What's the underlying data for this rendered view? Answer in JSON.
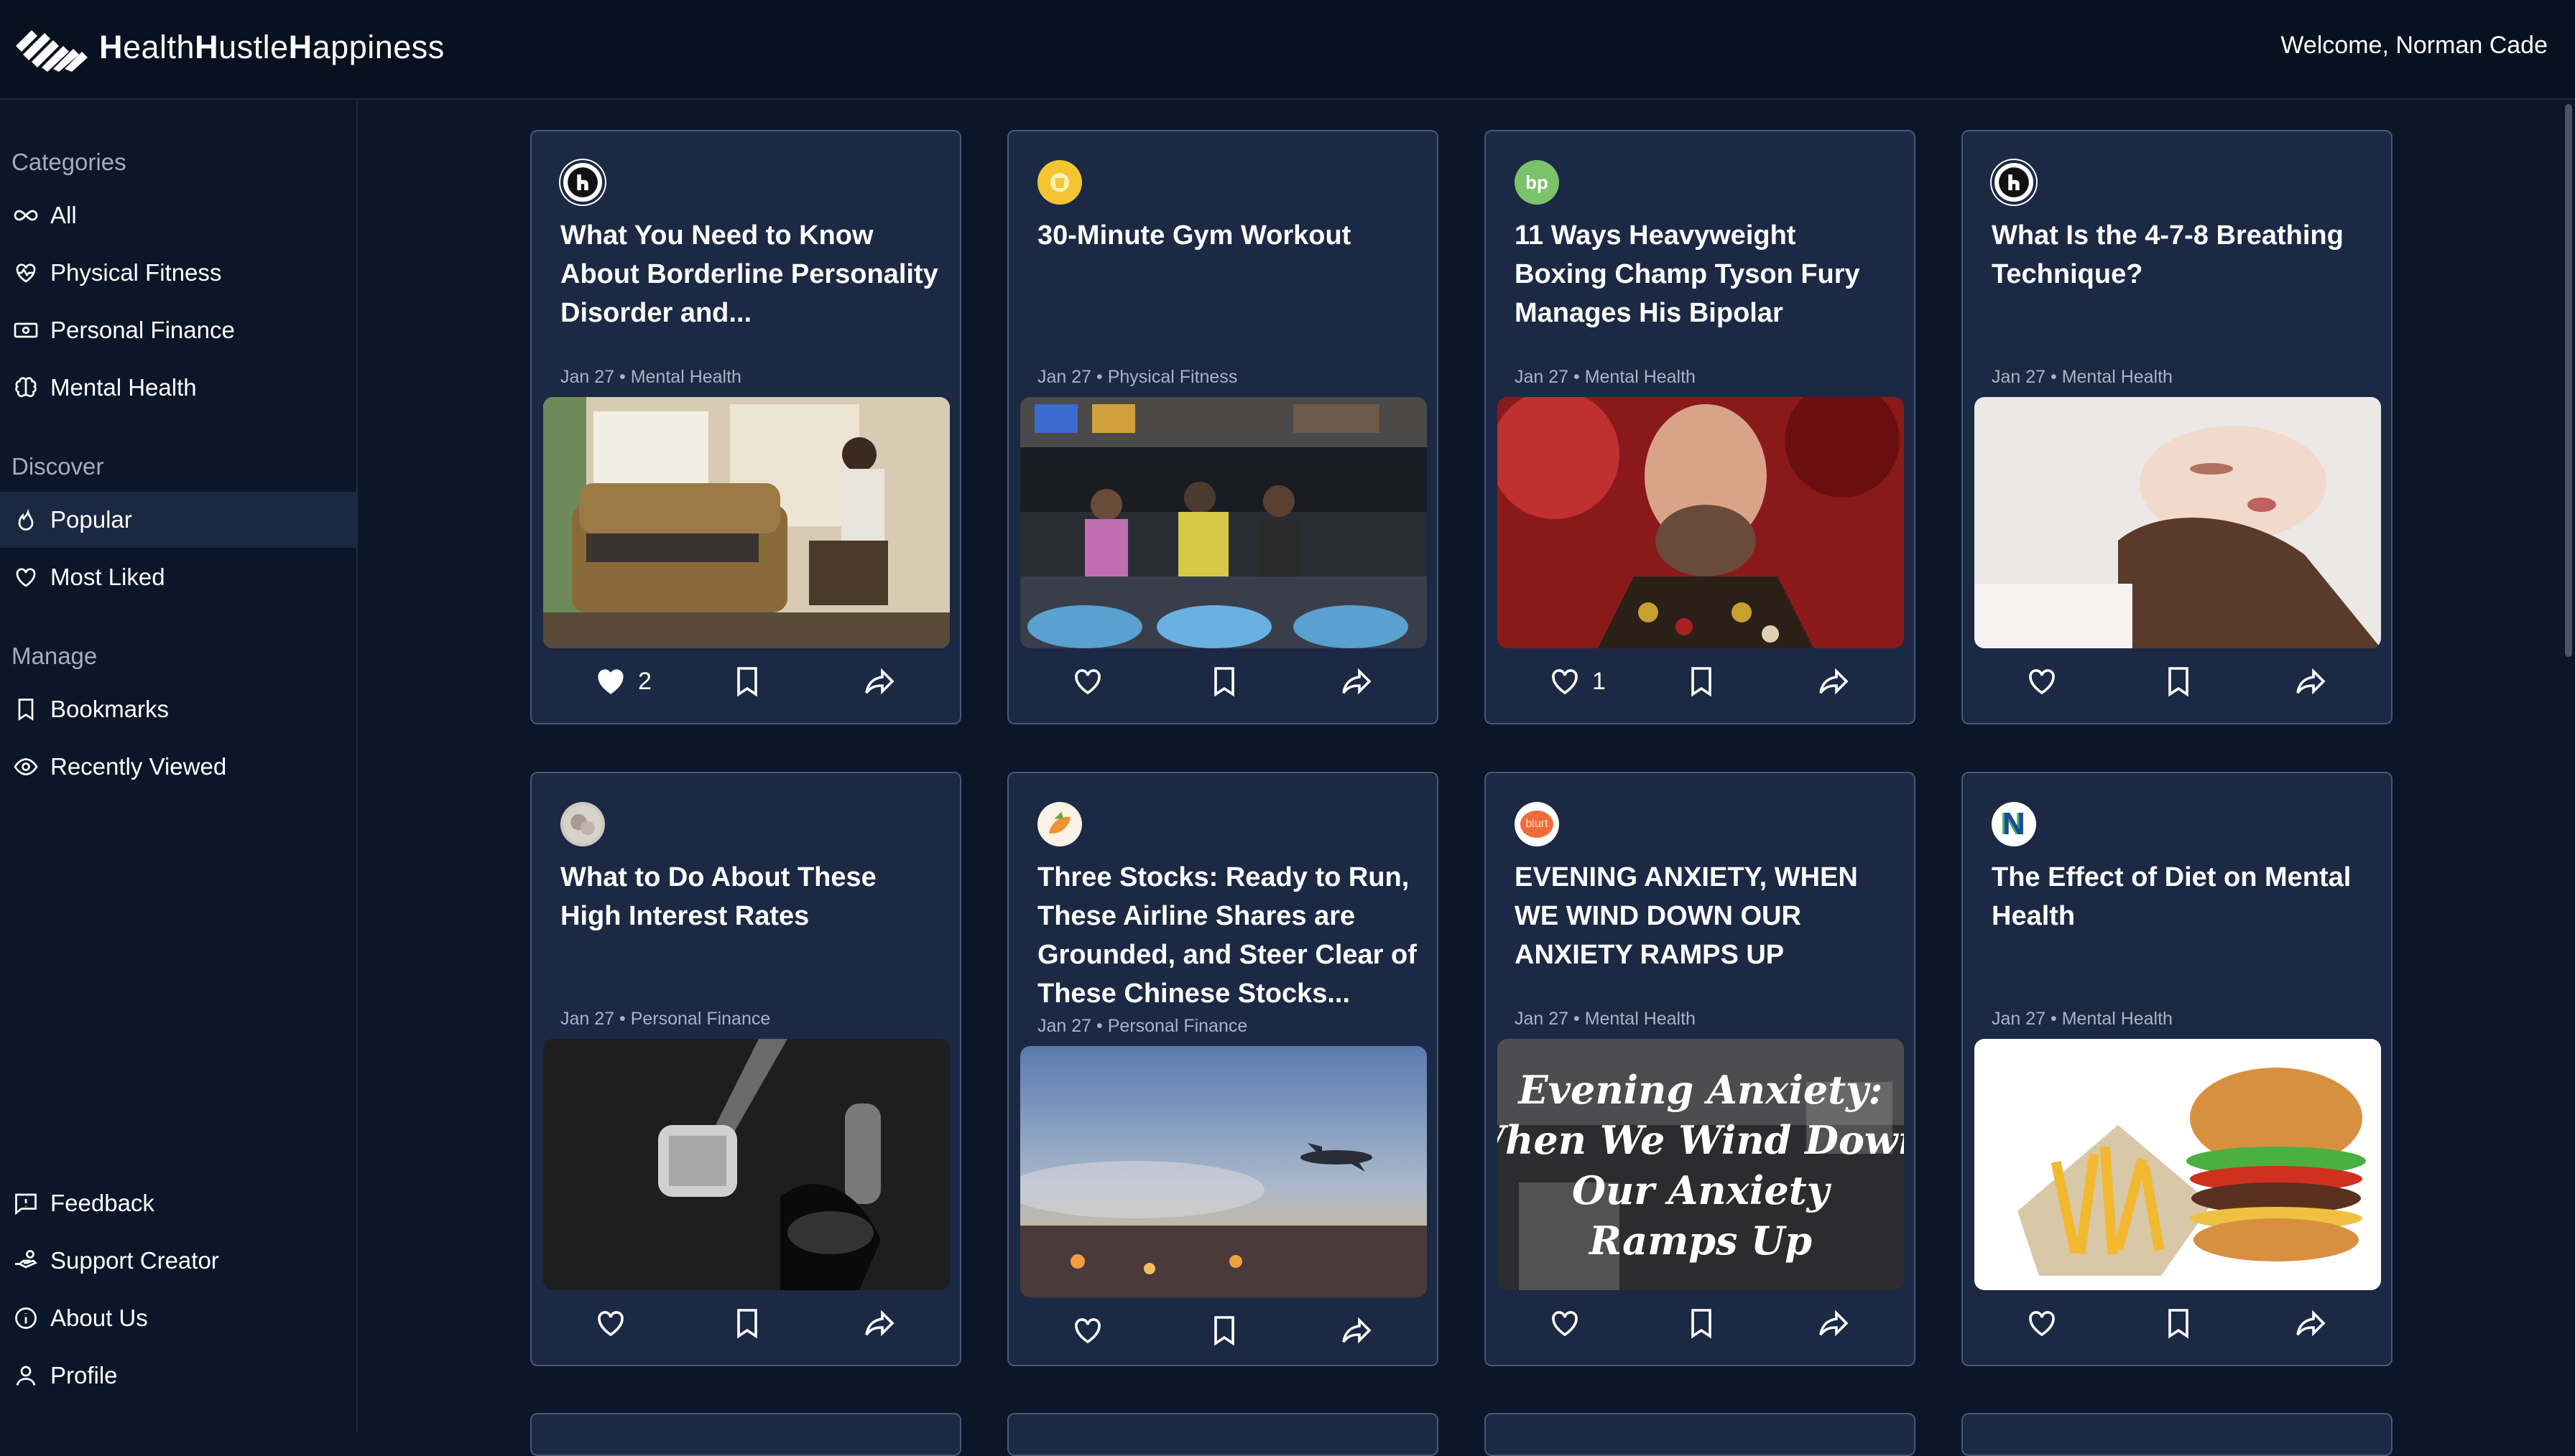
{
  "header": {
    "logo_part1_bold": "H",
    "logo_part1": "ealth",
    "logo_part2_bold": "H",
    "logo_part2": "ustle",
    "logo_part3_bold": "H",
    "logo_part3": "appiness",
    "welcome": "Welcome, Norman Cade"
  },
  "sidebar": {
    "categories_label": "Categories",
    "categories": [
      {
        "label": "All",
        "icon": "infinity-icon"
      },
      {
        "label": "Physical Fitness",
        "icon": "heart-pulse-icon"
      },
      {
        "label": "Personal Finance",
        "icon": "banknote-icon"
      },
      {
        "label": "Mental Health",
        "icon": "brain-icon"
      }
    ],
    "discover_label": "Discover",
    "discover": [
      {
        "label": "Popular",
        "icon": "flame-icon",
        "active": true
      },
      {
        "label": "Most Liked",
        "icon": "heart-icon"
      }
    ],
    "manage_label": "Manage",
    "manage": [
      {
        "label": "Bookmarks",
        "icon": "bookmark-icon"
      },
      {
        "label": "Recently Viewed",
        "icon": "eye-icon"
      }
    ],
    "bottom": [
      {
        "label": "Feedback",
        "icon": "message-alert-icon"
      },
      {
        "label": "Support Creator",
        "icon": "hand-coins-icon"
      },
      {
        "label": "About Us",
        "icon": "info-icon"
      },
      {
        "label": "Profile",
        "icon": "user-icon"
      }
    ]
  },
  "cards": [
    {
      "title": "What You Need to Know About Borderline Personality Disorder and...",
      "meta": "Jan 27 • Mental Health",
      "likes": "2",
      "liked": true,
      "source_icon": "h-logo"
    },
    {
      "title": "30-Minute Gym Workout",
      "meta": "Jan 27 • Physical Fitness",
      "likes": "",
      "liked": false,
      "source_icon": "yellow-logo"
    },
    {
      "title": "11 Ways Heavyweight Boxing Champ Tyson Fury Manages His Bipolar",
      "meta": "Jan 27 • Mental Health",
      "likes": "1",
      "liked": false,
      "source_icon": "bp-logo"
    },
    {
      "title": "What Is the 4-7-8 Breathing Technique?",
      "meta": "Jan 27 • Mental Health",
      "likes": "",
      "liked": false,
      "source_icon": "h-logo"
    },
    {
      "title": "What to Do About These High Interest Rates",
      "meta": "Jan 27 • Personal Finance",
      "likes": "",
      "liked": false,
      "source_icon": "round-photo-logo"
    },
    {
      "title": "Three Stocks: Ready to Run, These Airline Shares are Grounded, and Steer Clear of These Chinese Stocks...",
      "meta": "Jan 27 • Personal Finance",
      "likes": "",
      "liked": false,
      "source_icon": "fruit-logo"
    },
    {
      "title": "EVENING ANXIETY, WHEN WE WIND DOWN OUR ANXIETY RAMPS UP",
      "meta": "Jan 27 • Mental Health",
      "likes": "",
      "liked": false,
      "source_icon": "blurt-logo"
    },
    {
      "title": "The Effect of Diet on Mental Health",
      "meta": "Jan 27 • Mental Health",
      "likes": "",
      "liked": false,
      "source_icon": "n-logo"
    }
  ],
  "source_icons": {
    "bp": "bp",
    "blurt": "blurt",
    "n": "N"
  },
  "thumb_text": {
    "anxiety_line1": "Evening Anxiety:",
    "anxiety_line2": "When We Wind Down,",
    "anxiety_line3": "Our Anxiety",
    "anxiety_line4": "Ramps Up"
  },
  "colors": {
    "background": "#0b1628",
    "header": "#08111f",
    "card": "#1b2944",
    "card_border": "#46577a",
    "sidebar_active": "#1b2842",
    "muted_text": "#aab3c2"
  }
}
